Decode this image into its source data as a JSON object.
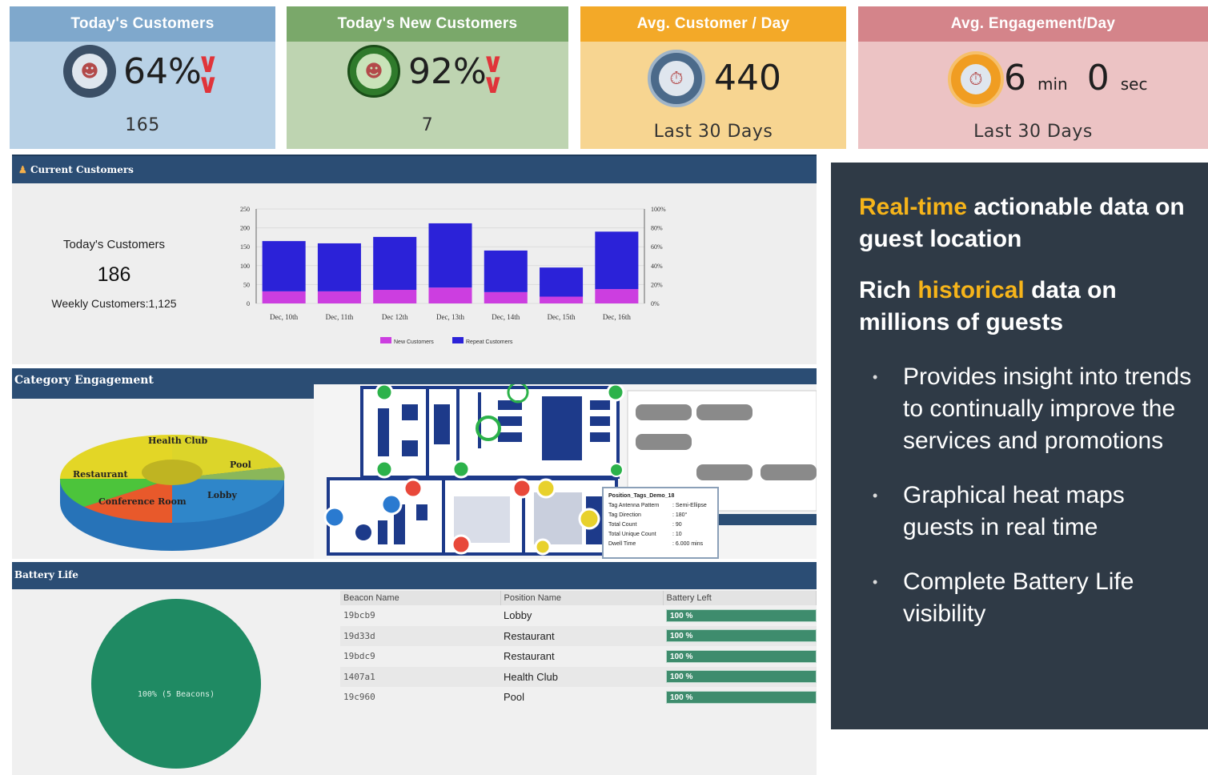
{
  "kpis": [
    {
      "title": "Today's Customers",
      "value": "64%",
      "sub": "165"
    },
    {
      "title": "Today's New Customers",
      "value": "92%",
      "sub": "7"
    },
    {
      "title": "Avg. Customer / Day",
      "value": "440",
      "sub": "Last 30 Days"
    },
    {
      "title": "Avg. Engagement/Day",
      "minutes": "6",
      "min_unit": "min",
      "seconds": "0",
      "sec_unit": "sec",
      "sub": "Last 30 Days"
    }
  ],
  "current_customers": {
    "title": "Current Customers",
    "today_label": "Today's Customers",
    "today_value": "186",
    "weekly_label": "Weekly Customers:1,125"
  },
  "chart_data": {
    "type": "bar",
    "categories": [
      "Dec, 10th",
      "Dec, 11th",
      "Dec 12th",
      "Dec, 13th",
      "Dec, 14th",
      "Dec, 15th",
      "Dec, 16th"
    ],
    "series": [
      {
        "name": "New Customers",
        "values": [
          32,
          32,
          36,
          42,
          30,
          18,
          38
        ]
      },
      {
        "name": "Repeat Customers",
        "values": [
          133,
          127,
          140,
          170,
          110,
          77,
          152
        ]
      }
    ],
    "stacked": true,
    "ylim": [
      0,
      250
    ],
    "yticks": [
      "250",
      "200",
      "150",
      "100",
      "50",
      "0"
    ],
    "y2ticks": [
      "100%",
      "80%",
      "60%",
      "40%",
      "20%",
      "0%"
    ],
    "colors": {
      "New Customers": "#cc3ee0",
      "Repeat Customers": "#2b22d8"
    },
    "legend": "bottom"
  },
  "category_engagement": {
    "title": "Category Engagement",
    "donut_labels": [
      "Health Club",
      "Pool",
      "Restaurant",
      "Lobby",
      "Conference Room"
    ],
    "tooltip": {
      "title": "Position_Tags_Demo_18",
      "rows": [
        [
          "Tag Antenna Pattern",
          ": Semi-Ellipse"
        ],
        [
          "Tag Direction",
          ": 180°"
        ],
        [
          "Total Count",
          ": 90"
        ],
        [
          "Total Unique Count",
          ": 10"
        ],
        [
          "Dwell Time",
          ": 6.000 mins"
        ]
      ]
    }
  },
  "battery": {
    "title": "Battery Life",
    "pie_label": "100% (5 Beacons)",
    "columns": [
      "Beacon Name",
      "Position Name",
      "Battery Left"
    ],
    "rows": [
      {
        "beacon": "19bcb9",
        "position": "Lobby",
        "battery": "100 %"
      },
      {
        "beacon": "19d33d",
        "position": "Restaurant",
        "battery": "100 %"
      },
      {
        "beacon": "19bdc9",
        "position": "Restaurant",
        "battery": "100 %"
      },
      {
        "beacon": "1407a1",
        "position": "Health Club",
        "battery": "100 %"
      },
      {
        "beacon": "19c960",
        "position": "Pool",
        "battery": "100 %"
      }
    ]
  },
  "info": {
    "h1_highlight": "Real-time",
    "h1_rest": " actionable data on  guest  location",
    "h2_pre": "Rich ",
    "h2_highlight": "historical",
    "h2_rest": " data on millions of guests",
    "bullets": [
      "Provides insight into trends to continually improve the services and promotions",
      "Graphical heat maps guests in real time",
      "Complete Battery Life visibility"
    ]
  }
}
